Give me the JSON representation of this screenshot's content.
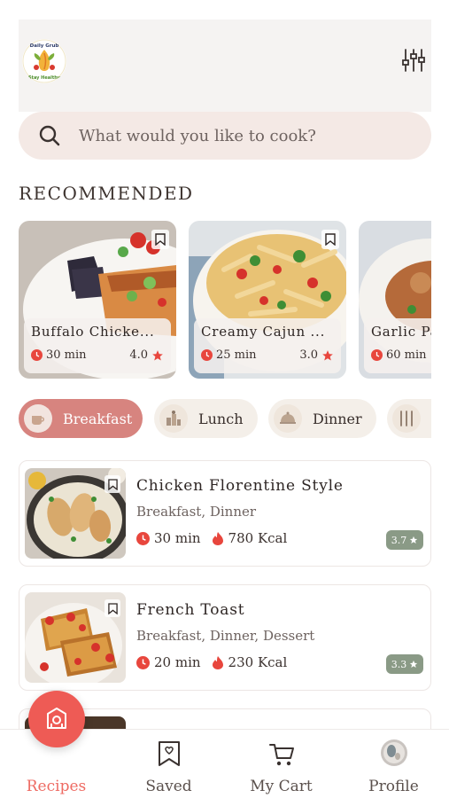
{
  "header": {
    "logo_text_top": "Daily Grub",
    "logo_text_bottom": "Stay Healthy",
    "filter_icon": "sliders-icon"
  },
  "search": {
    "placeholder": "What would you like to cook?",
    "value": ""
  },
  "recommended": {
    "title": "RECOMMENDED",
    "items": [
      {
        "title": "Buffalo Chicke...",
        "time": "30 min",
        "rating": "4.0"
      },
      {
        "title": "Creamy Cajun ...",
        "time": "25 min",
        "rating": "3.0"
      },
      {
        "title": "Garlic Pa",
        "time": "60 min",
        "rating": ""
      }
    ]
  },
  "categories": [
    {
      "label": "Breakfast",
      "active": true
    },
    {
      "label": "Lunch",
      "active": false
    },
    {
      "label": "Dinner",
      "active": false
    },
    {
      "label": "",
      "active": false
    }
  ],
  "dishes": [
    {
      "name": "Chicken Florentine Style",
      "categories": "Breakfast, Dinner",
      "time": "30 min",
      "kcal": "780 Kcal",
      "rating": "3.7"
    },
    {
      "name": "French Toast",
      "categories": "Breakfast, Dinner, Dessert",
      "time": "20 min",
      "kcal": "230 Kcal",
      "rating": "3.3"
    }
  ],
  "nav": {
    "recipes": "Recipes",
    "saved": "Saved",
    "cart": "My Cart",
    "profile": "Profile"
  },
  "colors": {
    "accent": "#ee5b55",
    "active_chip": "#d7847f",
    "rating_badge": "#8a9a86",
    "search_bg": "#f4e9e5"
  }
}
